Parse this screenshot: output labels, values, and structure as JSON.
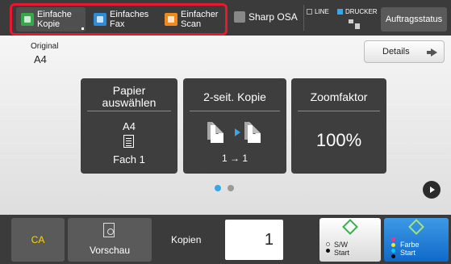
{
  "topbar": {
    "quick_buttons": [
      {
        "label": "Einfache Kopie",
        "icon": "copy-icon",
        "color": "#36a84a"
      },
      {
        "label": "Einfaches Fax",
        "icon": "fax-icon",
        "color": "#2f8ad8"
      },
      {
        "label": "Einfacher Scan",
        "icon": "scan-icon",
        "color": "#f08a1c"
      }
    ],
    "sharp_osa": "Sharp OSA",
    "line": "LINE",
    "drucker": "DRUCKER",
    "auftragsstatus": "Auftragsstatus",
    "highlight_color": "#e8192c"
  },
  "main": {
    "original_label": "Original",
    "original_value": "A4",
    "details": "Details",
    "tiles": {
      "paper": {
        "title": "Papier auswählen",
        "size": "A4",
        "tray": "Fach 1"
      },
      "duplex": {
        "title": "2-seit. Kopie",
        "page_a": "1",
        "page_b": "1",
        "mapping": "1 → 1"
      },
      "zoom": {
        "title": "Zoomfaktor",
        "value": "100%"
      }
    },
    "page_indicator": {
      "current": 1,
      "total": 2,
      "active_color": "#36a7e9",
      "inactive_color": "#9a9a9a"
    }
  },
  "bottom": {
    "ca": "CA",
    "vorschau": "Vorschau",
    "kopien_label": "Kopien",
    "kopien_value": "1",
    "start_bw": "S/W Start",
    "start_color": "Farbe Start"
  }
}
